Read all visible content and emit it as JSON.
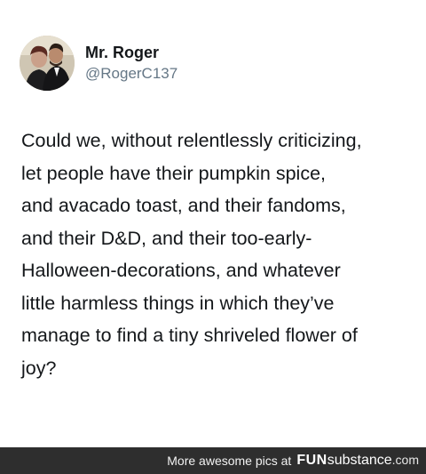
{
  "tweet": {
    "display_name": "Mr. Roger",
    "handle": "@RogerC137",
    "avatar_icon": "profile-photo-avatar",
    "lines": [
      "Could we, without relentlessly criticizing,",
      "let people have their pumpkin spice,",
      "and avacado toast, and their fandoms,",
      "and their D&D, and their too-early-",
      "Halloween-decorations, and whatever",
      "little harmless things in which they’ve",
      "manage to find a tiny shriveled flower of",
      "joy?"
    ]
  },
  "footer": {
    "text": "More awesome pics at",
    "brand_bold": "FUN",
    "brand_light": "substance",
    "brand_domain": ".com"
  }
}
